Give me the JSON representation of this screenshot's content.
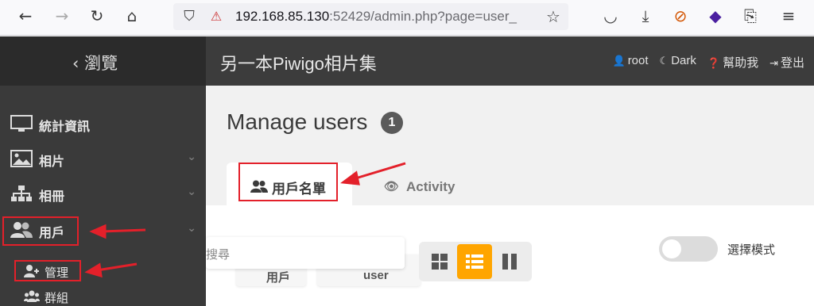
{
  "browser": {
    "url_host": "192.168.85.130",
    "url_rest": ":52429/admin.php?page=user_"
  },
  "header": {
    "back_label": "瀏覽",
    "gallery_title": "另一本Piwigo相片集",
    "user": "root",
    "theme": "Dark",
    "help": "幫助我",
    "logout": "登出"
  },
  "sidebar": {
    "items": [
      {
        "label": "統計資訊",
        "icon": "monitor-icon"
      },
      {
        "label": "相片",
        "icon": "image-icon"
      },
      {
        "label": "相冊",
        "icon": "sitemap-icon"
      },
      {
        "label": "用戶",
        "icon": "users-icon"
      }
    ],
    "sub_items": [
      {
        "label": "管理",
        "icon": "user-plus-icon"
      },
      {
        "label": "群組",
        "icon": "group-icon"
      }
    ]
  },
  "main": {
    "title": "Manage users",
    "count": "1",
    "tabs": [
      {
        "label": "用戶名單",
        "icon": "users-icon"
      },
      {
        "label": "Activity",
        "icon": "eye-icon"
      }
    ],
    "search_placeholder": "搜尋",
    "behind_buttons": [
      "用戶",
      "user"
    ],
    "toggle_label": "選擇模式"
  },
  "colors": {
    "accent": "#ffa500",
    "annotation": "#e3202a",
    "sidebar_bg": "#3a3a3a",
    "header_bg": "#3c3c3c"
  }
}
